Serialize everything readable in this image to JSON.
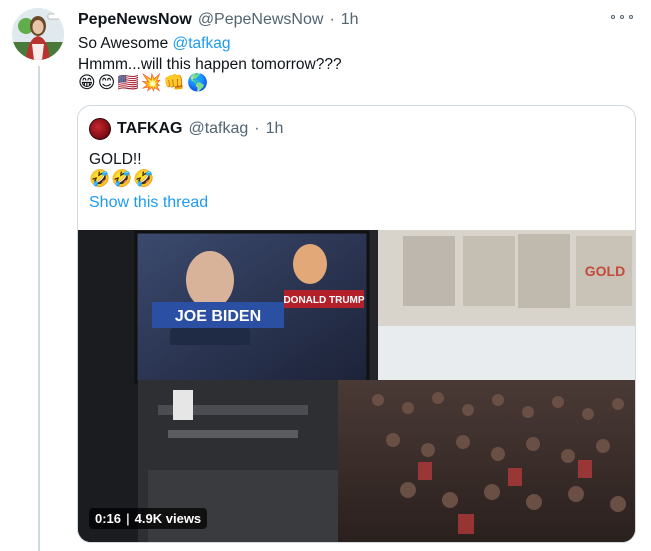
{
  "tweet": {
    "author_name": "PepeNewsNow",
    "author_handle": "@PepeNewsNow",
    "separator": "·",
    "time": "1h",
    "text_line1_prefix": "So Awesome ",
    "text_line1_mention": "@tafkag",
    "text_line2": "Hmmm...will this happen tomorrow???",
    "emojis": [
      "😁",
      "😊",
      "🇺🇸",
      "💥",
      "👊",
      "🌎"
    ]
  },
  "quoted_tweet": {
    "author_name": "TAFKAG",
    "author_handle": "@tafkag",
    "separator": "·",
    "time": "1h",
    "text": "GOLD!!",
    "emojis": [
      "🤣",
      "🤣",
      "🤣"
    ],
    "show_thread_label": "Show this thread",
    "video": {
      "timestamp": "0:16",
      "separator": "|",
      "views": "4.9K views",
      "screen_label_left": "JOE BIDEN",
      "screen_label_right": "DONALD TRUMP",
      "wall_text": "GOLD"
    }
  },
  "colors": {
    "accent": "#1d9bf0",
    "text": "#0f1419",
    "muted": "#536471",
    "border": "#cfd9de"
  }
}
